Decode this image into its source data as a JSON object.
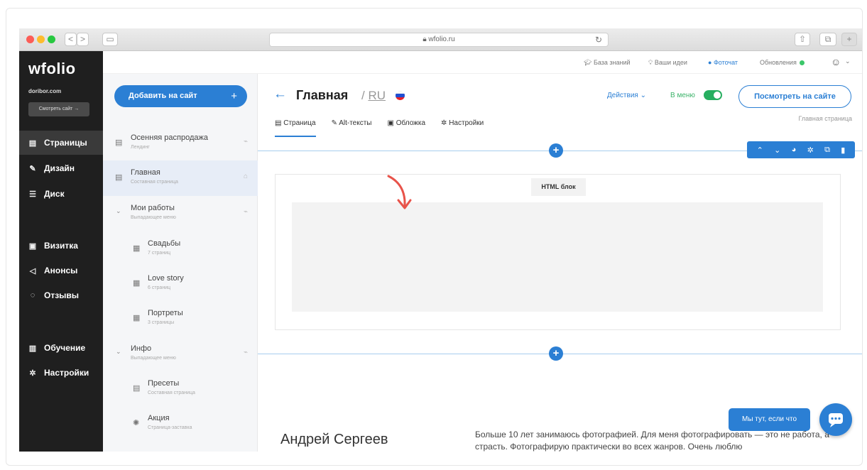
{
  "browser": {
    "url": "wfolio.ru",
    "back": "<",
    "forward": ">"
  },
  "sidebar": {
    "logo": "wfolio",
    "domain": "doribor.com",
    "view_site": "Смотреть сайт →",
    "items": [
      {
        "label": "Страницы",
        "icon": "page-icon"
      },
      {
        "label": "Дизайн",
        "icon": "pen-icon"
      },
      {
        "label": "Диск",
        "icon": "database-icon"
      },
      {
        "label": "Визитка",
        "icon": "card-icon"
      },
      {
        "label": "Анонсы",
        "icon": "megaphone-icon"
      },
      {
        "label": "Отзывы",
        "icon": "chat-icon"
      },
      {
        "label": "Обучение",
        "icon": "book-icon"
      },
      {
        "label": "Настройки",
        "icon": "gear-icon"
      }
    ]
  },
  "topbar": {
    "knowledge": "База знаний",
    "ideas": "Ваши идеи",
    "photochat": "Фоточат",
    "updates": "Обновления"
  },
  "panel": {
    "add_button": "Добавить на сайт",
    "items": [
      {
        "title": "Осенняя распродажа",
        "sub": "Лендинг"
      },
      {
        "title": "Главная",
        "sub": "Составная страница"
      },
      {
        "title": "Мои работы",
        "sub": "Выпадающее меню"
      },
      {
        "title": "Свадьбы",
        "sub": "7 страниц"
      },
      {
        "title": "Love story",
        "sub": "6 страниц"
      },
      {
        "title": "Портреты",
        "sub": "3 страницы"
      },
      {
        "title": "Инфо",
        "sub": "Выпадающее меню"
      },
      {
        "title": "Пресеты",
        "sub": "Составная страница"
      },
      {
        "title": "Акция",
        "sub": "Страница-заставка"
      }
    ]
  },
  "main": {
    "title": "Главная",
    "lang": "RU",
    "actions": "Действия",
    "in_menu": "В меню",
    "view_on_site": "Посмотреть на сайте",
    "breadcrumb": "Главная страница",
    "tabs": [
      "Страница",
      "Alt-тексты",
      "Обложка",
      "Настройки"
    ],
    "block_label": "HTML блок",
    "author_name": "Андрей Сергеев",
    "bio": "Больше 10 лет занимаюсь фотографией. Для меня фотографировать — это не работа, а страсть. Фотографирую практически во всех жанров. Очень люблю",
    "chat_label": "Мы тут, если что"
  },
  "colors": {
    "accent": "#2b7fd4",
    "sidebar_bg": "#1f1f1f",
    "toggle_on": "#27ae60"
  }
}
